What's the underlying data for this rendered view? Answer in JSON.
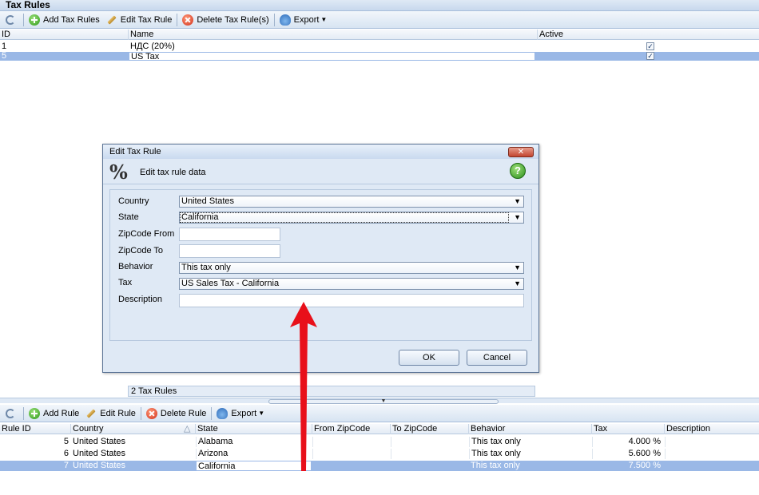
{
  "top_panel": {
    "title": "Tax Rules",
    "toolbar": {
      "add": "Add Tax Rules",
      "edit": "Edit Tax Rule",
      "delete": "Delete Tax Rule(s)",
      "export": "Export"
    },
    "columns": [
      "ID",
      "Name",
      "Active"
    ],
    "rows": [
      {
        "id": "1",
        "name": "НДС (20%)",
        "active": true
      },
      {
        "id": "5",
        "name": "US Tax",
        "active": true
      }
    ],
    "status": "2 Tax Rules"
  },
  "dialog": {
    "title": "Edit Tax Rule",
    "close": "✕",
    "subtitle": "Edit tax rule data",
    "icon_glyph": "%",
    "help_glyph": "?",
    "fields": {
      "country_label": "Country",
      "country_value": "United States",
      "state_label": "State",
      "state_value": "California",
      "zip_from_label": "ZipCode From",
      "zip_from_value": "",
      "zip_to_label": "ZipCode To",
      "zip_to_value": "",
      "behavior_label": "Behavior",
      "behavior_value": "This tax only",
      "tax_label": "Tax",
      "tax_value": "US Sales Tax - California",
      "description_label": "Description",
      "description_value": ""
    },
    "ok": "OK",
    "cancel": "Cancel"
  },
  "bottom_panel": {
    "toolbar": {
      "add": "Add Rule",
      "edit": "Edit Rule",
      "delete": "Delete Rule",
      "export": "Export"
    },
    "columns": [
      "Rule ID",
      "Country",
      "State",
      "From ZipCode",
      "To ZipCode",
      "Behavior",
      "Tax",
      "Description"
    ],
    "rows": [
      {
        "rule_id": "5",
        "country": "United States",
        "state": "Alabama",
        "from_zip": "",
        "to_zip": "",
        "behavior": "This tax only",
        "tax": "4.000 %",
        "description": ""
      },
      {
        "rule_id": "6",
        "country": "United States",
        "state": "Arizona",
        "from_zip": "",
        "to_zip": "",
        "behavior": "This tax only",
        "tax": "5.600 %",
        "description": ""
      },
      {
        "rule_id": "7",
        "country": "United States",
        "state": "California",
        "from_zip": "",
        "to_zip": "",
        "behavior": "This tax only",
        "tax": "7.500 %",
        "description": ""
      }
    ]
  },
  "colors": {
    "selection": "#9ab8e6",
    "toolbar": "#d7e4f2",
    "arrow": "#e8101a"
  }
}
